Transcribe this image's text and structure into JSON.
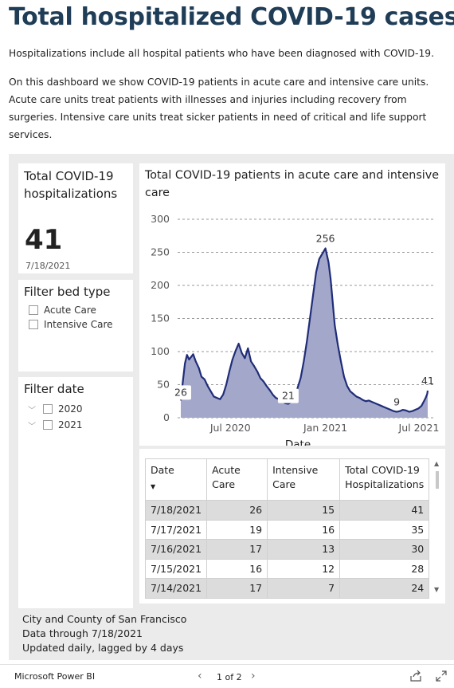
{
  "page": {
    "title": "Total hospitalized COVID-19 cases",
    "intro1": "Hospitalizations include all hospital patients who have been diagnosed with COVID-19.",
    "intro2": "On this dashboard we show COVID-19 patients in acute care and intensive care units. Acute care units treat patients with illnesses and injuries including recovery from surgeries. Intensive care units treat sicker patients in need of critical and life support services."
  },
  "kpi": {
    "title": "Total COVID-19 hospitalizations",
    "value": "41",
    "date": "7/18/2021"
  },
  "filter_bed": {
    "title": "Filter bed type",
    "options": [
      "Acute Care",
      "Intensive Care"
    ]
  },
  "filter_date": {
    "title": "Filter date",
    "options": [
      "2020",
      "2021"
    ]
  },
  "chart": {
    "title": "Total COVID-19 patients in acute care and intensive care"
  },
  "chart_data": {
    "type": "area",
    "title": "Total COVID-19 patients in acute care and intensive care",
    "xlabel": "Date",
    "ylabel": "",
    "ylim": [
      0,
      300
    ],
    "yticks": [
      0,
      50,
      100,
      150,
      200,
      250,
      300
    ],
    "xticks": [
      {
        "date": "2020-07-01",
        "label": "Jul 2020"
      },
      {
        "date": "2021-01-01",
        "label": "Jan 2021"
      },
      {
        "date": "2021-07-01",
        "label": "Jul 2021"
      }
    ],
    "grid": true,
    "colors": {
      "fill": "#a3a8cb",
      "line": "#1f2d78"
    },
    "series": [
      {
        "x": [
          "2020-03-27",
          "2020-03-31",
          "2020-04-04",
          "2020-04-08",
          "2020-04-12",
          "2020-04-16",
          "2020-04-20",
          "2020-04-25",
          "2020-05-01",
          "2020-05-06",
          "2020-05-12",
          "2020-05-18",
          "2020-05-24",
          "2020-05-30",
          "2020-06-05",
          "2020-06-11",
          "2020-06-17",
          "2020-06-23",
          "2020-06-29",
          "2020-07-05",
          "2020-07-11",
          "2020-07-17",
          "2020-07-23",
          "2020-07-29",
          "2020-08-04",
          "2020-08-10",
          "2020-08-16",
          "2020-08-22",
          "2020-08-28",
          "2020-09-03",
          "2020-09-09",
          "2020-09-15",
          "2020-09-21",
          "2020-09-27",
          "2020-10-03",
          "2020-10-09",
          "2020-10-15",
          "2020-10-21",
          "2020-10-27",
          "2020-11-02",
          "2020-11-08",
          "2020-11-14",
          "2020-11-20",
          "2020-11-26",
          "2020-12-02",
          "2020-12-08",
          "2020-12-14",
          "2020-12-20",
          "2020-12-26",
          "2021-01-01",
          "2021-01-07",
          "2021-01-11",
          "2021-01-15",
          "2021-01-19",
          "2021-01-25",
          "2021-01-31",
          "2021-02-06",
          "2021-02-12",
          "2021-02-18",
          "2021-02-24",
          "2021-03-02",
          "2021-03-08",
          "2021-03-14",
          "2021-03-20",
          "2021-03-26",
          "2021-04-01",
          "2021-04-07",
          "2021-04-13",
          "2021-04-19",
          "2021-04-25",
          "2021-05-01",
          "2021-05-07",
          "2021-05-13",
          "2021-05-19",
          "2021-05-25",
          "2021-05-31",
          "2021-06-06",
          "2021-06-12",
          "2021-06-18",
          "2021-06-24",
          "2021-06-30",
          "2021-07-06",
          "2021-07-10",
          "2021-07-14",
          "2021-07-17",
          "2021-07-18"
        ],
        "values": [
          26,
          55,
          82,
          95,
          88,
          92,
          96,
          85,
          75,
          62,
          58,
          48,
          40,
          32,
          30,
          28,
          35,
          50,
          70,
          88,
          101,
          112,
          98,
          90,
          105,
          85,
          78,
          70,
          60,
          55,
          48,
          42,
          35,
          30,
          28,
          25,
          22,
          21,
          24,
          30,
          45,
          60,
          85,
          115,
          150,
          185,
          220,
          240,
          248,
          256,
          235,
          210,
          175,
          140,
          110,
          85,
          62,
          48,
          40,
          36,
          32,
          30,
          27,
          25,
          26,
          24,
          22,
          20,
          18,
          16,
          14,
          12,
          10,
          9,
          10,
          12,
          11,
          9,
          10,
          12,
          14,
          18,
          24,
          30,
          36,
          41
        ]
      }
    ],
    "annotations": [
      {
        "date": "2020-03-27",
        "value": 26,
        "label": "26"
      },
      {
        "date": "2020-10-21",
        "value": 21,
        "label": "21"
      },
      {
        "date": "2021-01-01",
        "value": 256,
        "label": "256"
      },
      {
        "date": "2021-05-19",
        "value": 9,
        "label": "9"
      },
      {
        "date": "2021-07-18",
        "value": 41,
        "label": "41"
      }
    ]
  },
  "table": {
    "headers": [
      "Date",
      "Acute Care",
      "Intensive Care",
      "Total COVID-19 Hospitalizations"
    ],
    "rows": [
      [
        "7/18/2021",
        "26",
        "15",
        "41"
      ],
      [
        "7/17/2021",
        "19",
        "16",
        "35"
      ],
      [
        "7/16/2021",
        "17",
        "13",
        "30"
      ],
      [
        "7/15/2021",
        "16",
        "12",
        "28"
      ],
      [
        "7/14/2021",
        "17",
        "7",
        "24"
      ]
    ]
  },
  "footer": {
    "line1": "City and County of San Francisco",
    "line2": "Data through 7/18/2021",
    "line3": "Updated daily, lagged by 4 days"
  },
  "bar": {
    "brand": "Microsoft Power BI",
    "pager": "1 of 2"
  }
}
